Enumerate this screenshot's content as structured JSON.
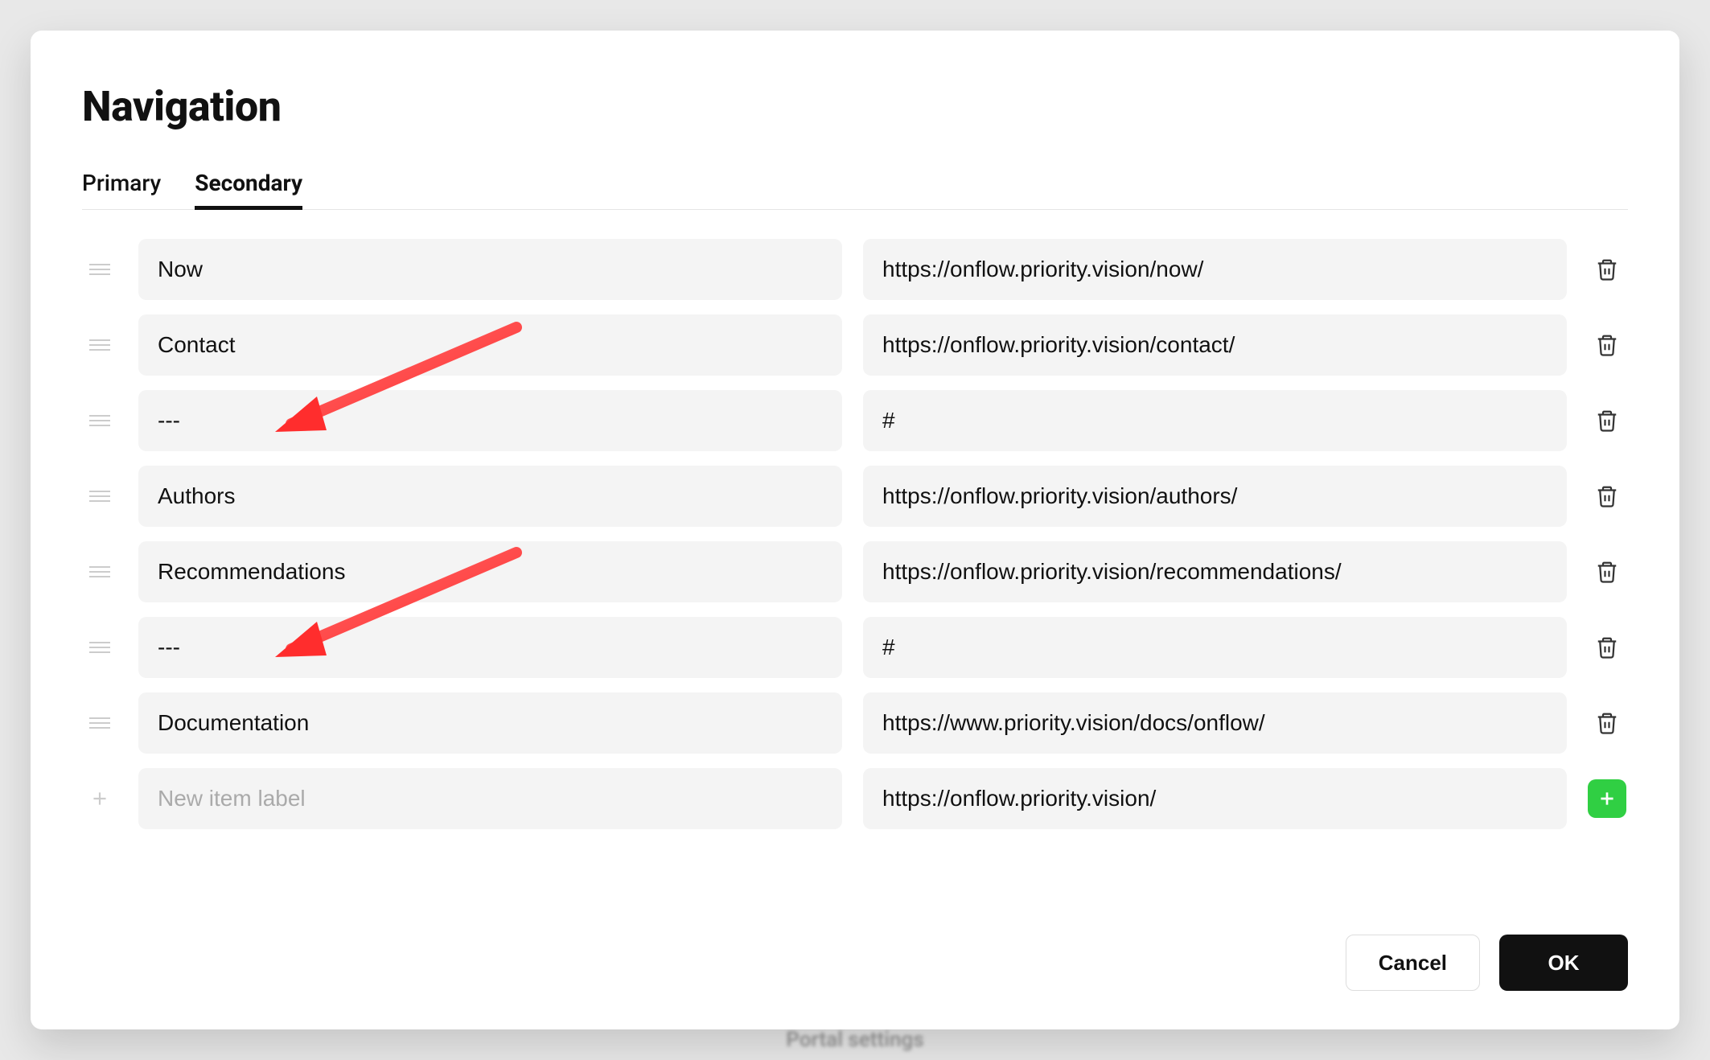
{
  "modal": {
    "title": "Navigation",
    "tabs": {
      "primary": "Primary",
      "secondary": "Secondary"
    },
    "newItem": {
      "placeholder": "New item label",
      "url": "https://onflow.priority.vision/"
    },
    "buttons": {
      "cancel": "Cancel",
      "ok": "OK"
    }
  },
  "items": [
    {
      "label": "Now",
      "url": "https://onflow.priority.vision/now/"
    },
    {
      "label": "Contact",
      "url": "https://onflow.priority.vision/contact/"
    },
    {
      "label": "---",
      "url": "#"
    },
    {
      "label": "Authors",
      "url": "https://onflow.priority.vision/authors/"
    },
    {
      "label": "Recommendations",
      "url": "https://onflow.priority.vision/recommendations/"
    },
    {
      "label": "---",
      "url": "#"
    },
    {
      "label": "Documentation",
      "url": "https://www.priority.vision/docs/onflow/"
    }
  ],
  "backdrop": "Portal settings"
}
